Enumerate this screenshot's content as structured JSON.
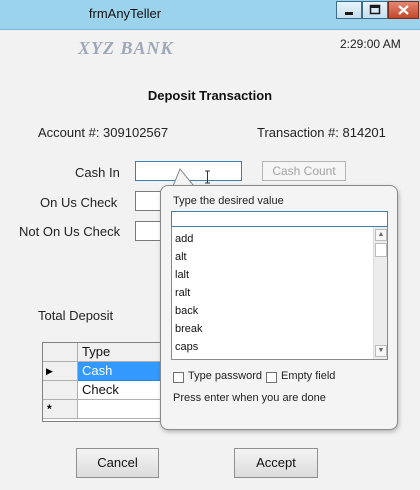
{
  "window": {
    "title": "frmAnyTeller"
  },
  "header": {
    "bank_name": "XYZ BANK",
    "time": "2:29:00 AM"
  },
  "form": {
    "heading": "Deposit Transaction",
    "account": "Account #: 309102567",
    "transaction": "Transaction #: 814201",
    "cash_in_label": "Cash In",
    "on_us_label": "On Us Check",
    "not_on_us_label": "Not On Us Check",
    "cash_count_button": "Cash Count",
    "total_deposit_label": "Total Deposit"
  },
  "grid": {
    "column_header": "Type",
    "rows": [
      "Cash",
      "Check",
      ""
    ],
    "selected_row": "Cash",
    "new_row_marker": "*",
    "current_row_marker": "▶"
  },
  "popup": {
    "prompt": "Type the desired value",
    "input_value": "",
    "options": [
      "add",
      "alt",
      "lalt",
      "ralt",
      "back",
      "break",
      "caps"
    ],
    "type_password_label": "Type password",
    "empty_field_label": "Empty field",
    "hint": "Press enter when you are done"
  },
  "buttons": {
    "cancel": "Cancel",
    "accept": "Accept"
  },
  "colors": {
    "titlebar": "#9bd3ec",
    "selection": "#3399ff",
    "close_button": "#c1492c"
  }
}
